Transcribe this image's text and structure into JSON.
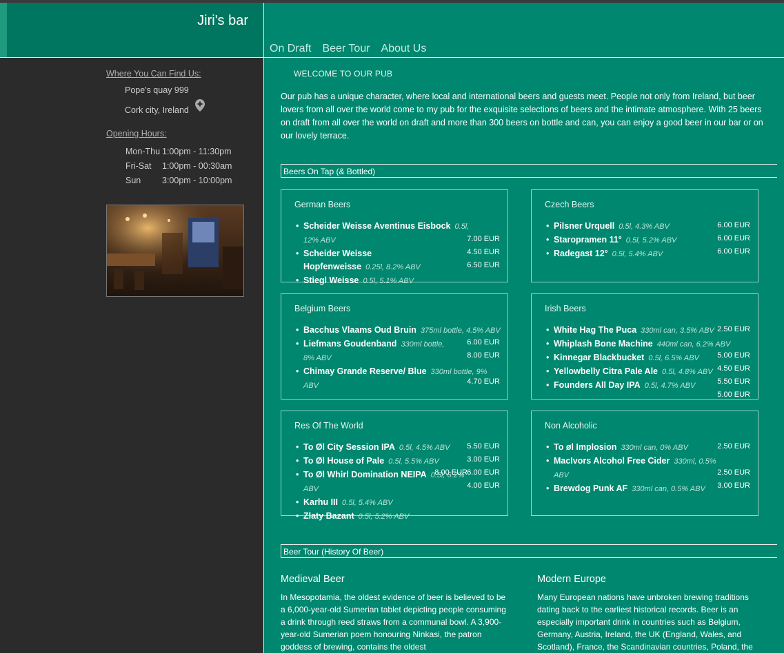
{
  "brand": {
    "title": "Jiri's bar"
  },
  "nav": {
    "items": [
      "On Draft",
      "Beer Tour",
      "About Us"
    ]
  },
  "sidebar": {
    "find_heading": "Where You Can Find Us:",
    "address_line1": "Pope's quay 999",
    "address_line2": "Cork city, Ireland",
    "hours_heading": "Opening Hours:",
    "hours": [
      {
        "days": "Mon-Thu",
        "time": "1:00pm - 11:30pm"
      },
      {
        "days": "Fri-Sat",
        "time": "1:00pm - 00:30am"
      },
      {
        "days": "Sun",
        "time": "3:00pm - 10:00pm"
      }
    ]
  },
  "main": {
    "welcome": "WELCOME TO OUR PUB",
    "intro": "Our pub has a unique character, where local and international beers and guests meet. People not only from Ireland, but beer lovers from all over the world come to my pub for the exquisite selections of beers and the intimate atmosphere. With 25 beers on draft from all over the world on draft and more than 300 beers on bottle and can, you can enjoy a good beer in our bar or on our lovely terrace.",
    "beers_heading": "Beers On Tap (& Bottled)",
    "tour_heading": "Beer Tour (History Of Beer)"
  },
  "beers": {
    "german": {
      "title": "German Beers",
      "items": [
        {
          "name": "Scheider Weisse Aventinus Eisbock",
          "spec": "0.5l, 12% ABV"
        },
        {
          "name": "Scheider Weisse Hopfenweisse",
          "spec": "0.25l, 8.2% ABV"
        },
        {
          "name": "Stiegl Weisse",
          "spec": "0.5l, 5.1% ABV"
        }
      ],
      "prices": [
        "7.00 EUR",
        "4.50 EUR",
        "6.50 EUR"
      ]
    },
    "czech": {
      "title": "Czech Beers",
      "items": [
        {
          "name": "Pilsner Urquell",
          "spec": "0.5l, 4.3% ABV"
        },
        {
          "name": "Staropramen 11°",
          "spec": "0.5l, 5.2% ABV"
        },
        {
          "name": "Radegast 12°",
          "spec": "0.5l, 5.4% ABV"
        }
      ],
      "prices": [
        "6.00 EUR",
        "6.00 EUR",
        "6.00 EUR"
      ]
    },
    "belgium": {
      "title": "Belgium Beers",
      "items": [
        {
          "name": "Bacchus Vlaams Oud Bruin",
          "spec": "375ml bottle, 4.5% ABV"
        },
        {
          "name": "Liefmans Goudenband",
          "spec": "330ml bottle, 8% ABV"
        },
        {
          "name": "Chimay Grande Reserve/ Blue",
          "spec": "330ml bottle, 9% ABV"
        }
      ],
      "prices": [
        "6.00 EUR",
        "8.00 EUR",
        "4.70 EUR"
      ]
    },
    "irish": {
      "title": "Irish Beers",
      "items": [
        {
          "name": "White Hag The Puca",
          "spec": "330ml can, 3.5% ABV"
        },
        {
          "name": "Whiplash Bone Machine",
          "spec": "440ml can, 6.2% ABV"
        },
        {
          "name": "Kinnegar Blackbucket",
          "spec": "0.5l, 6.5% ABV"
        },
        {
          "name": "Yellowbelly Citra Pale Ale",
          "spec": "0.5l, 4.8% ABV"
        },
        {
          "name": "Founders All Day IPA",
          "spec": "0.5l, 4.7% ABV"
        }
      ],
      "prices": [
        "2.50 EUR",
        "5.00 EUR",
        "4.50 EUR",
        "5.50 EUR",
        "5.00 EUR"
      ]
    },
    "world": {
      "title": "Res Of The World",
      "items": [
        {
          "name": "To Øl City Session IPA",
          "spec": "0.5l, 4.5% ABV"
        },
        {
          "name": "To Øl House of Pale",
          "spec": "0.5l, 5.5% ABV"
        },
        {
          "name": "To Øl Whirl Domination NEIPA",
          "spec": "0.5l, 6.2% ABV"
        },
        {
          "name": "Karhu III",
          "spec": "0.5l, 5.4% ABV"
        },
        {
          "name": "Zlaty Bazant",
          "spec": "0.5l, 5.2% ABV"
        }
      ],
      "prices": [
        "5.50 EUR",
        "3.00 EUR",
        "8.00 EUR",
        "6.00 EUR",
        "4.00 EUR"
      ]
    },
    "nonalc": {
      "title": "Non Alcoholic",
      "items": [
        {
          "name": "To øl Implosion",
          "spec": "330ml can, 0% ABV"
        },
        {
          "name": "MacIvors Alcohol Free Cider",
          "spec": "330ml, 0.5% ABV"
        },
        {
          "name": "Brewdog Punk AF",
          "spec": "330ml can, 0.5% ABV"
        }
      ],
      "prices": [
        "2.50 EUR",
        "2.50 EUR",
        "3.00 EUR"
      ]
    }
  },
  "history": {
    "medieval": {
      "title": "Medieval Beer",
      "text": "In Mesopotamia, the oldest evidence of beer is believed to be a 6,000-year-old Sumerian tablet depicting people consuming a drink through reed straws from a communal bowl. A 3,900-year-old Sumerian poem honouring Ninkasi, the patron goddess of brewing, contains the oldest"
    },
    "modern": {
      "title": "Modern Europe",
      "text": "Many European nations have unbroken brewing traditions dating back to the earliest historical records. Beer is an especially important drink in countries such as Belgium, Germany, Austria, Ireland, the UK (England, Wales, and Scotland), France, the Scandinavian countries, Poland, the"
    }
  },
  "colors": {
    "header": "#00876f",
    "brand_panel": "#00755f",
    "sidebar": "#2b2b2b",
    "main": "#00876f"
  }
}
